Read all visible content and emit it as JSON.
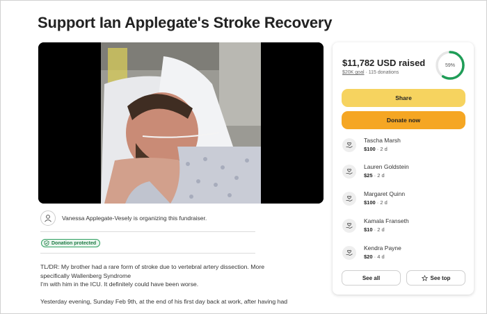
{
  "page": {
    "title": "Support Ian Applegate's Stroke Recovery"
  },
  "organizer": {
    "text": "Vanessa Applegate-Vesely is organizing this fundraiser."
  },
  "badge": {
    "label": "Donation protected"
  },
  "story": {
    "p1_line1": "TL/DR: My brother had a rare form of stroke due to vertebral artery dissection. More",
    "p1_line2": "specifically Wallenberg Syndrome",
    "p1_line3": "I'm with him in the ICU. It definitely could have been worse.",
    "p2_line1": "Yesterday evening, Sunday Feb 9th, at the end of his first day back at work, after having had"
  },
  "summary": {
    "raised": "$11,782 USD raised",
    "goal": "$20K goal",
    "separator": "·",
    "donation_count": "115 donations",
    "percent_label": "59%",
    "progress": 0.59
  },
  "actions": {
    "share": "Share",
    "donate": "Donate now",
    "see_all": "See all",
    "see_top": "See top"
  },
  "donations": [
    {
      "name": "Tascha Marsh",
      "amount": "$100",
      "age": "2 d"
    },
    {
      "name": "Lauren Goldstein",
      "amount": "$25",
      "age": "2 d"
    },
    {
      "name": "Margaret Quinn",
      "amount": "$100",
      "age": "2 d"
    },
    {
      "name": "Kamala Franseth",
      "amount": "$10",
      "age": "2 d"
    },
    {
      "name": "Kendra Payne",
      "amount": "$20",
      "age": "4 d"
    }
  ],
  "icons": {
    "organizer": "person-icon",
    "badge": "shield-check-icon",
    "donation": "heart-hand-icon",
    "see_top": "star-icon"
  },
  "colors": {
    "progress": "#1f9d57",
    "share_button": "#f6d35f",
    "donate_button": "#f5a623",
    "badge_green": "#2e9e5f"
  }
}
